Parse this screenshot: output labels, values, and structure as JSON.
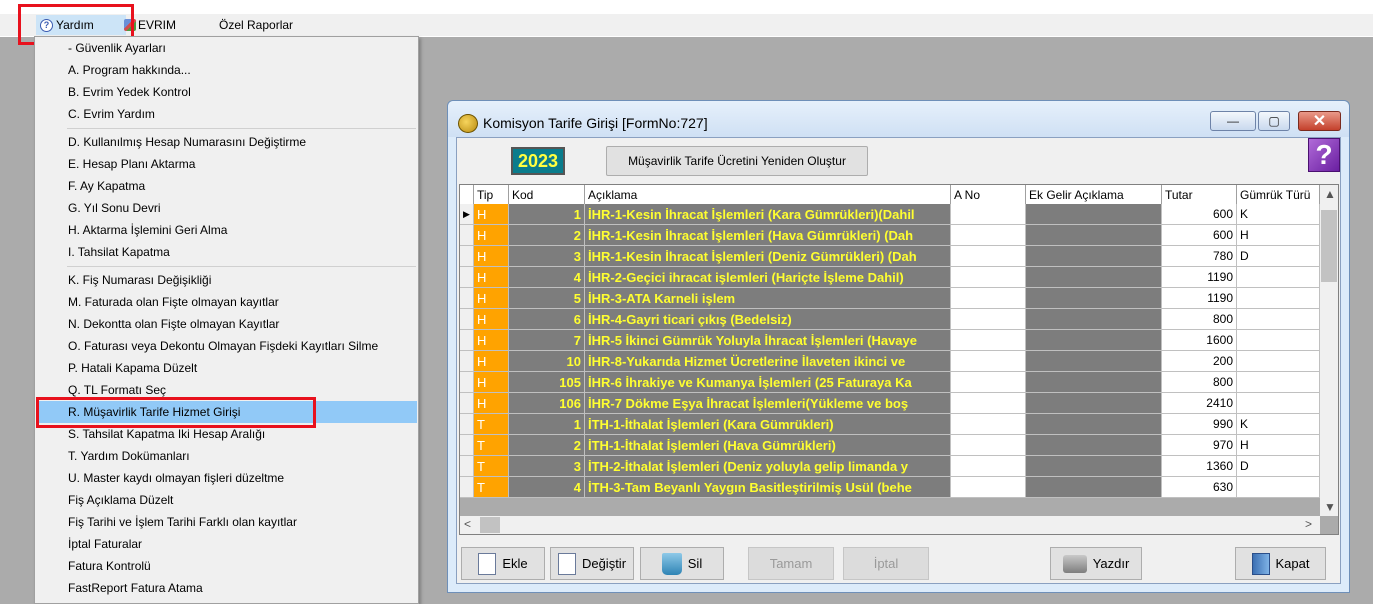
{
  "menubar": {
    "items": [
      {
        "label": "Yardım",
        "icon": "help-icon"
      },
      {
        "label": "EVRIM",
        "icon": "evrim-icon"
      },
      {
        "label": "Özel Raporlar"
      }
    ]
  },
  "dropdown": {
    "items": [
      {
        "label": "- Güvenlik Ayarları"
      },
      {
        "label": "A.  Program hakkında..."
      },
      {
        "label": "B.  Evrim Yedek Kontrol"
      },
      {
        "label": "C.  Evrim Yardım"
      },
      {
        "label": "D.  Kullanılmış Hesap Numarasını Değiştirme"
      },
      {
        "label": "E.  Hesap Planı Aktarma"
      },
      {
        "label": "F.  Ay Kapatma"
      },
      {
        "label": "G.  Yıl Sonu Devri"
      },
      {
        "label": "H.  Aktarma İşlemini Geri Alma"
      },
      {
        "label": "I.  Tahsilat Kapatma"
      },
      {
        "label": "K.  Fiş Numarası Değişikliği"
      },
      {
        "label": "M. Faturada olan Fişte olmayan kayıtlar"
      },
      {
        "label": "N.  Dekontta olan Fişte olmayan Kayıtlar"
      },
      {
        "label": "O. Faturası veya Dekontu Olmayan Fişdeki Kayıtları Silme"
      },
      {
        "label": "P. Hatali Kapama Düzelt"
      },
      {
        "label": "Q. TL Formatı Seç"
      },
      {
        "label": "R. Müşavirlik Tarife Hizmet Girişi"
      },
      {
        "label": "S.  Tahsilat Kapatma Iki Hesap Aralığı"
      },
      {
        "label": "T. Yardım Dokümanları"
      },
      {
        "label": "U. Master kaydı olmayan fişleri düzeltme"
      },
      {
        "label": "Fiş Açıklama Düzelt"
      },
      {
        "label": "Fiş Tarihi ve İşlem Tarihi Farklı olan kayıtlar"
      },
      {
        "label": "İptal Faturalar"
      },
      {
        "label": "Fatura Kontrolü"
      },
      {
        "label": "FastReport Fatura Atama"
      }
    ]
  },
  "window": {
    "title": "Komisyon Tarife Girişi [FormNo:727]",
    "controls": {
      "minimize": "—",
      "maximize": "▢",
      "close": "✕"
    },
    "year": "2023",
    "recalc_button": "Müşavirlik Tarife Ücretini Yeniden Oluştur",
    "help_glyph": "?"
  },
  "grid": {
    "columns": [
      "Tip",
      "Kod",
      "Açıklama",
      "A No",
      "Ek Gelir Açıklama",
      "Tutar",
      "Gümrük Türü"
    ],
    "current_row_marker": "▶",
    "rows": [
      {
        "tip": "H",
        "kod": "1",
        "aciklama": "İHR-1-Kesin İhracat İşlemleri (Kara Gümrükleri)(Dahil",
        "ano": "",
        "ek": "",
        "tutar": "600",
        "gumruk": "K"
      },
      {
        "tip": "H",
        "kod": "2",
        "aciklama": "İHR-1-Kesin İhracat İşlemleri (Hava Gümrükleri) (Dah",
        "ano": "",
        "ek": "",
        "tutar": "600",
        "gumruk": "H"
      },
      {
        "tip": "H",
        "kod": "3",
        "aciklama": "İHR-1-Kesin İhracat İşlemleri (Deniz Gümrükleri) (Dah",
        "ano": "",
        "ek": "",
        "tutar": "780",
        "gumruk": "D"
      },
      {
        "tip": "H",
        "kod": "4",
        "aciklama": "İHR-2-Geçici ihracat işlemleri (Hariçte İşleme Dahil)",
        "ano": "",
        "ek": "",
        "tutar": "1190",
        "gumruk": ""
      },
      {
        "tip": "H",
        "kod": "5",
        "aciklama": "İHR-3-ATA Karneli işlem",
        "ano": "",
        "ek": "",
        "tutar": "1190",
        "gumruk": ""
      },
      {
        "tip": "H",
        "kod": "6",
        "aciklama": "İHR-4-Gayri ticari çıkış (Bedelsiz)",
        "ano": "",
        "ek": "",
        "tutar": "800",
        "gumruk": ""
      },
      {
        "tip": "H",
        "kod": "7",
        "aciklama": "İHR-5 İkinci Gümrük Yoluyla İhracat İşlemleri (Havaye",
        "ano": "",
        "ek": "",
        "tutar": "1600",
        "gumruk": ""
      },
      {
        "tip": "H",
        "kod": "10",
        "aciklama": "İHR-8-Yukarıda Hizmet Ücretlerine İlaveten ikinci ve",
        "ano": "",
        "ek": "",
        "tutar": "200",
        "gumruk": ""
      },
      {
        "tip": "H",
        "kod": "105",
        "aciklama": "İHR-6 İhrakiye ve Kumanya İşlemleri (25 Faturaya Ka",
        "ano": "",
        "ek": "",
        "tutar": "800",
        "gumruk": ""
      },
      {
        "tip": "H",
        "kod": "106",
        "aciklama": "İHR-7 Dökme Eşya İhracat İşlemleri(Yükleme ve boş",
        "ano": "",
        "ek": "",
        "tutar": "2410",
        "gumruk": ""
      },
      {
        "tip": "T",
        "kod": "1",
        "aciklama": "İTH-1-İthalat İşlemleri  (Kara Gümrükleri)",
        "ano": "",
        "ek": "",
        "tutar": "990",
        "gumruk": "K"
      },
      {
        "tip": "T",
        "kod": "2",
        "aciklama": "İTH-1-İthalat İşlemleri  (Hava Gümrükleri)",
        "ano": "",
        "ek": "",
        "tutar": "970",
        "gumruk": "H"
      },
      {
        "tip": "T",
        "kod": "3",
        "aciklama": "İTH-2-İthalat İşlemleri (Deniz yoluyla gelip limanda y",
        "ano": "",
        "ek": "",
        "tutar": "1360",
        "gumruk": "D"
      },
      {
        "tip": "T",
        "kod": "4",
        "aciklama": "İTH-3-Tam Beyanlı Yaygın Basitleştirilmiş Usül (behe",
        "ano": "",
        "ek": "",
        "tutar": "630",
        "gumruk": ""
      }
    ],
    "scroll": {
      "up": "▲",
      "down": "▼",
      "left": "<",
      "right": ">"
    }
  },
  "toolbar": {
    "ekle": "Ekle",
    "degistir": "Değiştir",
    "sil": "Sil",
    "tamam": "Tamam",
    "iptal": "İptal",
    "yazdir": "Yazdır",
    "kapat": "Kapat"
  },
  "colors": {
    "highlight": "#91c9f7",
    "callout": "#e8111d",
    "tip_cell": "#ffa300",
    "grid_text": "#ffff30"
  }
}
